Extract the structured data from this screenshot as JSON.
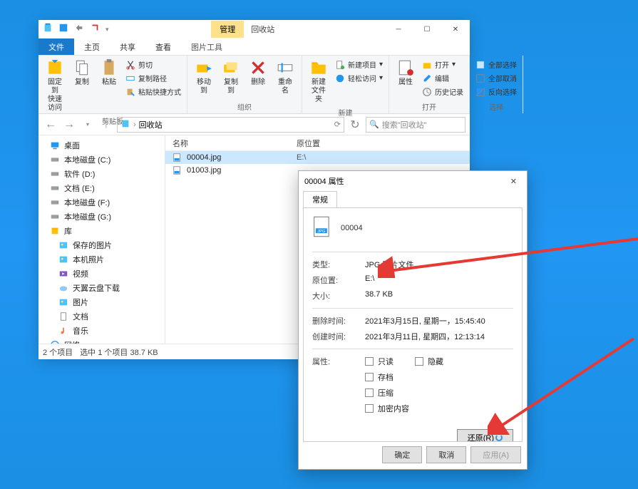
{
  "explorer": {
    "manage_tab": "管理",
    "title": "回收站",
    "tabs": {
      "file": "文件",
      "home": "主页",
      "share": "共享",
      "view": "查看",
      "pic": "图片工具"
    },
    "ribbon": {
      "pin": "固定到\n快速访问",
      "copy": "复制",
      "paste": "粘贴",
      "cut": "剪切",
      "copy_path": "复制路径",
      "paste_short": "粘贴快捷方式",
      "g_clipboard": "剪贴板",
      "move_to": "移动到",
      "copy_to": "复制到",
      "delete": "删除",
      "rename": "重命名",
      "g_org": "组织",
      "new_folder": "新建\n文件夹",
      "new_item": "新建项目",
      "easy_access": "轻松访问",
      "g_new": "新建",
      "properties": "属性",
      "open": "打开",
      "edit": "编辑",
      "history": "历史记录",
      "g_open": "打开",
      "select_all": "全部选择",
      "select_none": "全部取消",
      "invert": "反向选择",
      "g_select": "选择"
    },
    "breadcrumb": "回收站",
    "search_placeholder": "搜索\"回收站\"",
    "tree": [
      {
        "icon": "desktop",
        "label": "桌面"
      },
      {
        "icon": "drive",
        "label": "本地磁盘 (C:)"
      },
      {
        "icon": "drive",
        "label": "软件 (D:)"
      },
      {
        "icon": "drive",
        "label": "文档 (E:)"
      },
      {
        "icon": "drive",
        "label": "本地磁盘 (F:)"
      },
      {
        "icon": "drive",
        "label": "本地磁盘 (G:)"
      },
      {
        "icon": "library",
        "label": "库"
      },
      {
        "icon": "pictures",
        "label": "保存的图片",
        "sub": true
      },
      {
        "icon": "pictures",
        "label": "本机照片",
        "sub": true
      },
      {
        "icon": "video",
        "label": "视频",
        "sub": true
      },
      {
        "icon": "cloud",
        "label": "天翼云盘下载",
        "sub": true
      },
      {
        "icon": "pictures",
        "label": "图片",
        "sub": true
      },
      {
        "icon": "document",
        "label": "文档",
        "sub": true
      },
      {
        "icon": "music",
        "label": "音乐",
        "sub": true
      },
      {
        "icon": "network",
        "label": "网络"
      }
    ],
    "cols": {
      "name": "名称",
      "loc": "原位置"
    },
    "files": [
      {
        "name": "00004.jpg",
        "loc": "E:\\",
        "selected": true
      },
      {
        "name": "01003.jpg",
        "loc": "",
        "selected": false
      }
    ],
    "status": {
      "count": "2 个项目",
      "sel": "选中 1 个项目 38.7 KB"
    }
  },
  "props": {
    "title": "00004 属性",
    "tab": "常规",
    "filename": "00004",
    "rows": {
      "type_l": "类型:",
      "type_v": "JPG 图片文件",
      "loc_l": "原位置:",
      "loc_v": "E:\\",
      "size_l": "大小:",
      "size_v": "38.7 KB",
      "deleted_l": "删除时间:",
      "deleted_v": "2021年3月15日, 星期一，15:45:40",
      "created_l": "创建时间:",
      "created_v": "2021年3月11日, 星期四，12:13:14",
      "attr_l": "属性:"
    },
    "attrs": {
      "readonly": "只读",
      "hidden": "隐藏",
      "archive": "存档",
      "compress": "压缩",
      "encrypt": "加密内容"
    },
    "restore": "还原(R)",
    "buttons": {
      "ok": "确定",
      "cancel": "取消",
      "apply": "应用(A)"
    }
  }
}
